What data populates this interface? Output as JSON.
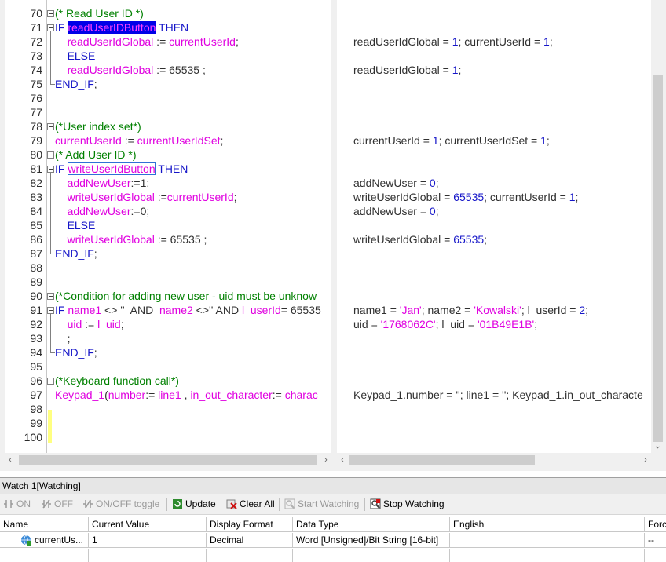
{
  "editor": {
    "code_lines": [
      {
        "num": "70",
        "fold": "start",
        "html": "<span class='cm'>(* Read User ID *)</span>"
      },
      {
        "num": "71",
        "fold": "start",
        "html": "<span class='kw'>IF </span><span class='hl'>readUserIDButton</span><span class='kw'> THEN</span>"
      },
      {
        "num": "72",
        "fold": "",
        "html": "    <span class='v'>readUserIdGlobal</span><span class='n'> := </span><span class='v'>currentUserId</span><span class='n'>;</span>"
      },
      {
        "num": "73",
        "fold": "",
        "html": "    <span class='kw'>ELSE</span>"
      },
      {
        "num": "74",
        "fold": "",
        "html": "    <span class='v'>readUserIdGlobal</span><span class='n'> := 65535 ;</span>"
      },
      {
        "num": "75",
        "fold": "end",
        "html": "<span class='kw'>END_IF</span><span class='n'>;</span>"
      },
      {
        "num": "76",
        "fold": "",
        "html": ""
      },
      {
        "num": "77",
        "fold": "",
        "html": ""
      },
      {
        "num": "78",
        "fold": "start",
        "html": "<span class='cm'>(*User index set*)</span>"
      },
      {
        "num": "79",
        "fold": "",
        "html": "<span class='v'>currentUserId</span><span class='n'> := </span><span class='v'>currentUserIdSet</span><span class='n'>;</span>"
      },
      {
        "num": "80",
        "fold": "start",
        "html": "<span class='cm'>(* Add User ID *)</span>"
      },
      {
        "num": "81",
        "fold": "start",
        "html": "<span class='kw'>IF </span><span class='v box'>writeUserIdButton</span><span class='kw'> THEN</span>"
      },
      {
        "num": "82",
        "fold": "",
        "html": "    <span class='v'>addNewUser</span><span class='n'>:=1;</span>"
      },
      {
        "num": "83",
        "fold": "",
        "html": "    <span class='v'>writeUserIdGlobal</span><span class='n'> :=</span><span class='v'>currentUserId</span><span class='n'>;</span>"
      },
      {
        "num": "84",
        "fold": "",
        "html": "    <span class='v'>addNewUser</span><span class='n'>:=0;</span>"
      },
      {
        "num": "85",
        "fold": "",
        "html": "    <span class='kw'>ELSE</span>"
      },
      {
        "num": "86",
        "fold": "",
        "html": "    <span class='v'>writeUserIdGlobal</span><span class='n'> := 65535 ;</span>"
      },
      {
        "num": "87",
        "fold": "end",
        "html": "<span class='kw'>END_IF</span><span class='n'>;</span>"
      },
      {
        "num": "88",
        "fold": "",
        "html": ""
      },
      {
        "num": "89",
        "fold": "",
        "html": ""
      },
      {
        "num": "90",
        "fold": "start",
        "html": "<span class='cm'>(*Condition for adding new user - uid must be unknow</span>"
      },
      {
        "num": "91",
        "fold": "start",
        "html": "<span class='kw'>IF </span><span class='v'>name1</span><span class='n'> &lt;&gt; ''  AND  </span><span class='v'>name2</span><span class='n'> &lt;&gt;'' AND </span><span class='v'>l_userId</span><span class='n'>= 65535</span>"
      },
      {
        "num": "92",
        "fold": "",
        "html": "    <span class='v'>uid</span><span class='n'> := </span><span class='v'>l_uid</span><span class='n'>;</span>"
      },
      {
        "num": "93",
        "fold": "",
        "html": "    <span class='n'>;</span>"
      },
      {
        "num": "94",
        "fold": "end",
        "html": "<span class='kw'>END_IF</span><span class='n'>;</span>"
      },
      {
        "num": "95",
        "fold": "",
        "html": ""
      },
      {
        "num": "96",
        "fold": "start",
        "html": "<span class='cm'>(*Keyboard function call*)</span>"
      },
      {
        "num": "97",
        "fold": "",
        "html": "<span class='v'>Keypad_1</span><span class='n'>(</span><span class='v'>number</span><span class='n'>:= </span><span class='v'>line1</span><span class='n'> , </span><span class='v'>in_out_character</span><span class='n'>:= </span><span class='v'>charac</span>"
      },
      {
        "num": "98",
        "fold": "",
        "html": ""
      },
      {
        "num": "99",
        "fold": "",
        "html": ""
      },
      {
        "num": "100",
        "fold": "",
        "html": ""
      }
    ],
    "monitor_lines": [
      {
        "row": 2,
        "html": "<span class='n'>readUserIdGlobal = </span><span class='num'>1</span><span class='n'>; currentUserId = </span><span class='num'>1</span><span class='n'>;</span>"
      },
      {
        "row": 4,
        "html": "<span class='n'>readUserIdGlobal = </span><span class='num'>1</span><span class='n'>;</span>"
      },
      {
        "row": 9,
        "html": "<span class='n'>currentUserId = </span><span class='num'>1</span><span class='n'>; currentUserIdSet = </span><span class='num'>1</span><span class='n'>;</span>"
      },
      {
        "row": 12,
        "html": "<span class='n'>addNewUser = </span><span class='num'>0</span><span class='n'>;</span>"
      },
      {
        "row": 13,
        "html": "<span class='n'>writeUserIdGlobal = </span><span class='num'>65535</span><span class='n'>; currentUserId = </span><span class='num'>1</span><span class='n'>;</span>"
      },
      {
        "row": 14,
        "html": "<span class='n'>addNewUser = </span><span class='num'>0</span><span class='n'>;</span>"
      },
      {
        "row": 16,
        "html": "<span class='n'>writeUserIdGlobal = </span><span class='num'>65535</span><span class='n'>;</span>"
      },
      {
        "row": 21,
        "html": "<span class='n'>name1 = </span><span class='str'>'Jan'</span><span class='n'>; name2 = </span><span class='str'>'Kowalski'</span><span class='n'>; l_userId = </span><span class='num'>2</span><span class='n'>;</span>"
      },
      {
        "row": 22,
        "html": "<span class='n'>uid = </span><span class='str'>'1768062C'</span><span class='n'>; l_uid = </span><span class='str'>'01B49E1B'</span><span class='n'>;</span>"
      },
      {
        "row": 27,
        "html": "<span class='n'>Keypad_1.number = ''; line1 = ''; Keypad_1.in_out_characte</span>"
      }
    ]
  },
  "watch": {
    "title": "Watch 1[Watching]",
    "toolbar": {
      "on": "ON",
      "off": "OFF",
      "toggle": "ON/OFF toggle",
      "update": "Update",
      "clear_all": "Clear All",
      "start_watching": "Start Watching",
      "stop_watching": "Stop Watching"
    },
    "columns": {
      "name": "Name",
      "current_value": "Current Value",
      "display_format": "Display Format",
      "data_type": "Data Type",
      "english": "English",
      "force": "Forc"
    },
    "row": {
      "name": "currentUs...",
      "current_value": "1",
      "display_format": "Decimal",
      "data_type": "Word [Unsigned]/Bit String [16-bit]",
      "english": "",
      "force": "--"
    }
  },
  "colors": {
    "keyword": "#1515c8",
    "variable": "#e000e0",
    "comment": "#008000",
    "selection": "#0000e8"
  }
}
